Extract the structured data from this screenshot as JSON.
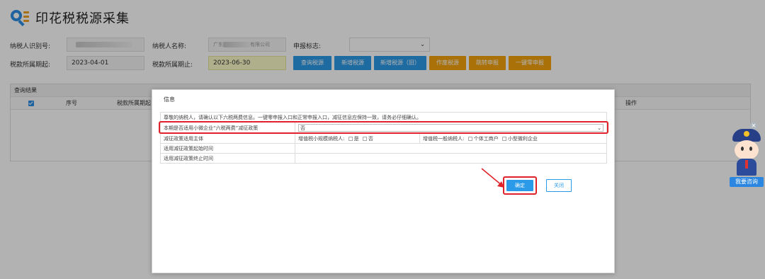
{
  "page": {
    "title": "印花税税源采集"
  },
  "form": {
    "taxpayer_id_label": "纳税人识别号:",
    "taxpayer_name_label": "纳税人名称:",
    "taxpayer_name_prefix": "广东",
    "taxpayer_name_suffix": "有限公司",
    "declare_flag_label": "申报标志:",
    "period_start_label": "税款所属期起:",
    "period_start_value": "2023-04-01",
    "period_end_label": "税款所属期止:",
    "period_end_value": "2023-06-30"
  },
  "toolbar": {
    "query": "查询税源",
    "add": "新增税源",
    "add_old": "新增税源（旧）",
    "void": "作废税源",
    "goto_declare": "跳转申报",
    "zero_declare": "一键零申报"
  },
  "results": {
    "header": "查询结果",
    "columns": {
      "seq": "序号",
      "period_start": "税款所属期起",
      "operation": "操作"
    }
  },
  "dialog": {
    "title": "信息",
    "notice": "尊敬的纳税人，请确认以下六税两费信息。一键零申报入口和正常申报入口，减征信息应保持一致，请务必仔细确认。",
    "rows": {
      "policy_label": "本期是否适用小微企业“六税两费”减征政策",
      "policy_value": "否",
      "subject_label": "减征政策适用主体",
      "small_scale_label": "增值税小规模纳税人:",
      "yes": "是",
      "no": "否",
      "general_label": "增值税一般纳税人:",
      "individual": "个体工商户",
      "micro": "小型微利企业",
      "start_label": "适用减征政策起始时间",
      "end_label": "适用减征政策终止时间"
    },
    "confirm": "确定",
    "close": "关闭"
  },
  "assistant": {
    "label": "我要咨询",
    "close": "×"
  }
}
